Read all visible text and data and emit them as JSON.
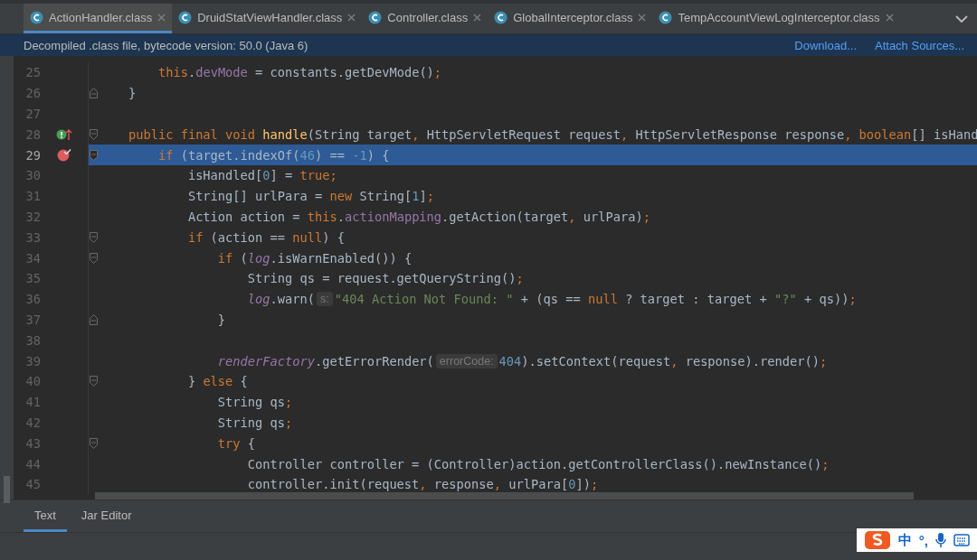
{
  "tabs": [
    {
      "label": "ActionHandler.class",
      "selected": true
    },
    {
      "label": "DruidStatViewHandler.class",
      "selected": false
    },
    {
      "label": "Controller.class",
      "selected": false
    },
    {
      "label": "GlobalInterceptor.class",
      "selected": false
    },
    {
      "label": "TempAccountViewLogInterceptor.class",
      "selected": false
    }
  ],
  "banner": {
    "message": "Decompiled .class file, bytecode version: 50.0 (Java 6)",
    "links": [
      "Download...",
      "Attach Sources..."
    ]
  },
  "lines": [
    {
      "number": "25",
      "selected": false,
      "fold_start": false,
      "fold_end": false,
      "override_mark": false,
      "breakpoint": false,
      "tokens": [
        {
          "kind": "keyword",
          "text": "        this"
        },
        {
          "kind": "plain",
          "text": "."
        },
        {
          "kind": "field",
          "text": "devMode"
        },
        {
          "kind": "plain",
          "text": " = constants.getDevMode()"
        },
        {
          "kind": "keyword",
          "text": ";"
        }
      ]
    },
    {
      "number": "26",
      "selected": false,
      "fold_start": false,
      "fold_end": true,
      "override_mark": false,
      "breakpoint": false,
      "tokens": [
        {
          "kind": "plain",
          "text": "    }"
        }
      ]
    },
    {
      "number": "27",
      "selected": false,
      "fold_start": false,
      "fold_end": false,
      "override_mark": false,
      "breakpoint": false
    },
    {
      "number": "28",
      "selected": false,
      "fold_start": true,
      "fold_end": false,
      "override_mark": true,
      "breakpoint": false,
      "tokens": [
        {
          "kind": "keyword",
          "text": "    public final void "
        },
        {
          "kind": "method",
          "text": "handle"
        },
        {
          "kind": "plain",
          "text": "(String target"
        },
        {
          "kind": "keyword",
          "text": ","
        },
        {
          "kind": "plain",
          "text": " HttpServletRequest request"
        },
        {
          "kind": "keyword",
          "text": ","
        },
        {
          "kind": "plain",
          "text": " HttpServletResponse response"
        },
        {
          "kind": "keyword",
          "text": ", boolean"
        },
        {
          "kind": "plain",
          "text": "[] isHand"
        }
      ]
    },
    {
      "number": "29",
      "selected": true,
      "fold_start": true,
      "fold_end": false,
      "override_mark": false,
      "breakpoint": true,
      "tokens": [
        {
          "kind": "keyword",
          "text": "        if"
        },
        {
          "kind": "plain",
          "text": " (target.indexOf("
        },
        {
          "kind": "number",
          "text": "46"
        },
        {
          "kind": "plain",
          "text": ") == "
        },
        {
          "kind": "number",
          "text": "-1"
        },
        {
          "kind": "plain",
          "text": ") {"
        }
      ]
    },
    {
      "number": "30",
      "selected": false,
      "fold_start": false,
      "fold_end": false,
      "override_mark": false,
      "breakpoint": false,
      "tokens": [
        {
          "kind": "plain",
          "text": "            isHandled["
        },
        {
          "kind": "number",
          "text": "0"
        },
        {
          "kind": "plain",
          "text": "] = "
        },
        {
          "kind": "keyword",
          "text": "true;"
        }
      ]
    },
    {
      "number": "31",
      "selected": false,
      "fold_start": false,
      "fold_end": false,
      "override_mark": false,
      "breakpoint": false,
      "tokens": [
        {
          "kind": "plain",
          "text": "            String[] urlPara = "
        },
        {
          "kind": "keyword",
          "text": "new"
        },
        {
          "kind": "plain",
          "text": " String["
        },
        {
          "kind": "number",
          "text": "1"
        },
        {
          "kind": "plain",
          "text": "]"
        },
        {
          "kind": "keyword",
          "text": ";"
        }
      ]
    },
    {
      "number": "32",
      "selected": false,
      "fold_start": false,
      "fold_end": false,
      "override_mark": false,
      "breakpoint": false,
      "tokens": [
        {
          "kind": "plain",
          "text": "            Action action = "
        },
        {
          "kind": "keyword",
          "text": "this"
        },
        {
          "kind": "plain",
          "text": "."
        },
        {
          "kind": "field",
          "text": "actionMapping"
        },
        {
          "kind": "plain",
          "text": ".getAction(target"
        },
        {
          "kind": "keyword",
          "text": ","
        },
        {
          "kind": "plain",
          "text": " urlPara)"
        },
        {
          "kind": "keyword",
          "text": ";"
        }
      ]
    },
    {
      "number": "33",
      "selected": false,
      "fold_start": true,
      "fold_end": false,
      "override_mark": false,
      "breakpoint": false,
      "tokens": [
        {
          "kind": "keyword",
          "text": "            if"
        },
        {
          "kind": "plain",
          "text": " (action == "
        },
        {
          "kind": "keyword",
          "text": "null"
        },
        {
          "kind": "plain",
          "text": ") {"
        }
      ]
    },
    {
      "number": "34",
      "selected": false,
      "fold_start": true,
      "fold_end": false,
      "override_mark": false,
      "breakpoint": false,
      "tokens": [
        {
          "kind": "keyword",
          "text": "                if"
        },
        {
          "kind": "plain",
          "text": " ("
        },
        {
          "kind": "static",
          "text": "log"
        },
        {
          "kind": "plain",
          "text": ".isWarnEnabled()) {"
        }
      ]
    },
    {
      "number": "35",
      "selected": false,
      "fold_start": false,
      "fold_end": false,
      "override_mark": false,
      "breakpoint": false,
      "tokens": [
        {
          "kind": "plain",
          "text": "                    String qs = request.getQueryString()"
        },
        {
          "kind": "keyword",
          "text": ";"
        }
      ]
    },
    {
      "number": "36",
      "selected": false,
      "fold_start": false,
      "fold_end": false,
      "override_mark": false,
      "breakpoint": false,
      "tokens": [
        {
          "kind": "static",
          "text": "                    log"
        },
        {
          "kind": "plain",
          "text": ".warn("
        },
        {
          "kind": "hint",
          "text": "s:"
        },
        {
          "kind": "string",
          "text": "\"404 Action Not Found: \""
        },
        {
          "kind": "plain",
          "text": " + (qs == "
        },
        {
          "kind": "keyword",
          "text": "null"
        },
        {
          "kind": "plain",
          "text": " ? target : target + "
        },
        {
          "kind": "string",
          "text": "\"?\""
        },
        {
          "kind": "plain",
          "text": " + qs))"
        },
        {
          "kind": "keyword",
          "text": ";"
        }
      ]
    },
    {
      "number": "37",
      "selected": false,
      "fold_start": false,
      "fold_end": true,
      "override_mark": false,
      "breakpoint": false,
      "tokens": [
        {
          "kind": "plain",
          "text": "                }"
        }
      ]
    },
    {
      "number": "38",
      "selected": false,
      "fold_start": false,
      "fold_end": false,
      "override_mark": false,
      "breakpoint": false
    },
    {
      "number": "39",
      "selected": false,
      "fold_start": false,
      "fold_end": false,
      "override_mark": false,
      "breakpoint": false,
      "tokens": [
        {
          "kind": "static",
          "text": "                renderFactory"
        },
        {
          "kind": "plain",
          "text": ".getErrorRender("
        },
        {
          "kind": "hint",
          "text": "errorCode:"
        },
        {
          "kind": "number",
          "text": "404"
        },
        {
          "kind": "plain",
          "text": ").setContext(request"
        },
        {
          "kind": "keyword",
          "text": ","
        },
        {
          "kind": "plain",
          "text": " response).render()"
        },
        {
          "kind": "keyword",
          "text": ";"
        }
      ]
    },
    {
      "number": "40",
      "selected": false,
      "fold_start": true,
      "fold_end": false,
      "override_mark": false,
      "breakpoint": false,
      "tokens": [
        {
          "kind": "plain",
          "text": "            } "
        },
        {
          "kind": "keyword",
          "text": "else"
        },
        {
          "kind": "plain",
          "text": " {"
        }
      ]
    },
    {
      "number": "41",
      "selected": false,
      "fold_start": false,
      "fold_end": false,
      "override_mark": false,
      "breakpoint": false,
      "tokens": [
        {
          "kind": "plain",
          "text": "                String qs"
        },
        {
          "kind": "keyword",
          "text": ";"
        }
      ]
    },
    {
      "number": "42",
      "selected": false,
      "fold_start": false,
      "fold_end": false,
      "override_mark": false,
      "breakpoint": false,
      "tokens": [
        {
          "kind": "plain",
          "text": "                String qs"
        },
        {
          "kind": "keyword",
          "text": ";"
        }
      ]
    },
    {
      "number": "43",
      "selected": false,
      "fold_start": true,
      "fold_end": false,
      "override_mark": false,
      "breakpoint": false,
      "tokens": [
        {
          "kind": "keyword",
          "text": "                try"
        },
        {
          "kind": "plain",
          "text": " {"
        }
      ]
    },
    {
      "number": "44",
      "selected": false,
      "fold_start": false,
      "fold_end": false,
      "override_mark": false,
      "breakpoint": false,
      "tokens": [
        {
          "kind": "plain",
          "text": "                    Controller controller = (Controller)action.getControllerClass().newInstance()"
        },
        {
          "kind": "keyword",
          "text": ";"
        }
      ]
    },
    {
      "number": "45",
      "selected": false,
      "fold_start": false,
      "fold_end": false,
      "override_mark": false,
      "breakpoint": false,
      "tokens": [
        {
          "kind": "plain",
          "text": "                    controller.init(request"
        },
        {
          "kind": "keyword",
          "text": ","
        },
        {
          "kind": "plain",
          "text": " response"
        },
        {
          "kind": "keyword",
          "text": ","
        },
        {
          "kind": "plain",
          "text": " urlPara["
        },
        {
          "kind": "number",
          "text": "0"
        },
        {
          "kind": "plain",
          "text": "])"
        },
        {
          "kind": "keyword",
          "text": ";"
        }
      ]
    }
  ],
  "bottom_tabs": [
    {
      "label": "Text",
      "selected": true
    },
    {
      "label": "Jar Editor",
      "selected": false
    }
  ],
  "input_method_bar": {
    "labels": [
      "中",
      "°,"
    ]
  }
}
